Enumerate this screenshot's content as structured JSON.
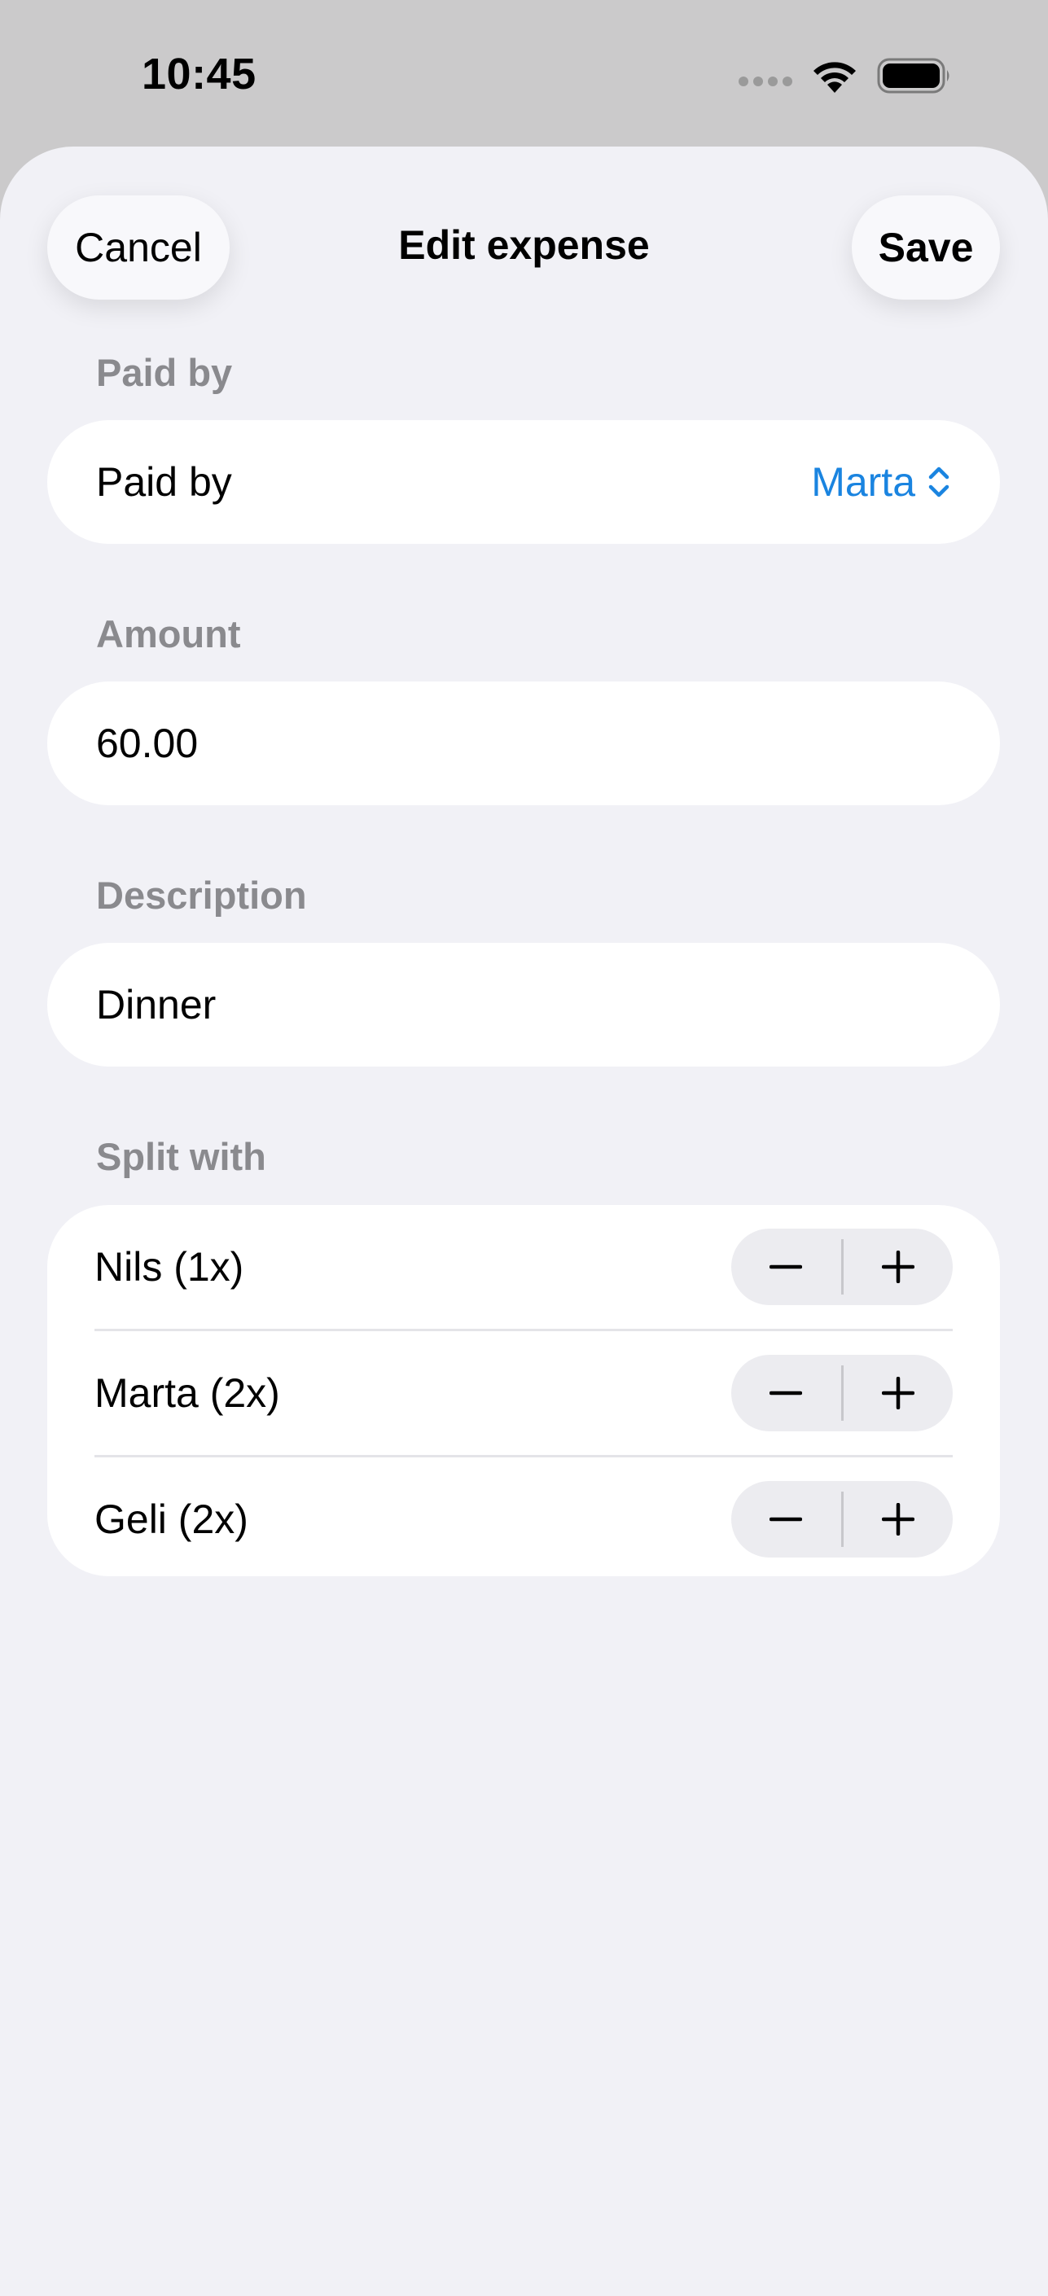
{
  "status_bar": {
    "time": "10:45",
    "icons": [
      "cellular-signal-icon",
      "wifi-icon",
      "battery-icon"
    ]
  },
  "header": {
    "cancel_label": "Cancel",
    "title": "Edit expense",
    "save_label": "Save"
  },
  "paid_by": {
    "section_label": "Paid by",
    "row_label": "Paid by",
    "selected_value": "Marta",
    "icon": "chevron-up-down-icon"
  },
  "amount": {
    "section_label": "Amount",
    "value": "60.00"
  },
  "description": {
    "section_label": "Description",
    "value": "Dinner"
  },
  "split": {
    "section_label": "Split with",
    "members": [
      {
        "label": "Nils (1x)",
        "decrement": "minus-icon",
        "increment": "plus-icon"
      },
      {
        "label": "Marta (2x)",
        "decrement": "minus-icon",
        "increment": "plus-icon"
      },
      {
        "label": "Geli (2x)",
        "decrement": "minus-icon",
        "increment": "plus-icon"
      }
    ]
  },
  "colors": {
    "accent": "#1a84e0",
    "sheet_background": "#f1f1f6",
    "card_background": "#ffffff",
    "section_label": "#8a8a8e",
    "dimmed_background": "#cbcacb"
  }
}
